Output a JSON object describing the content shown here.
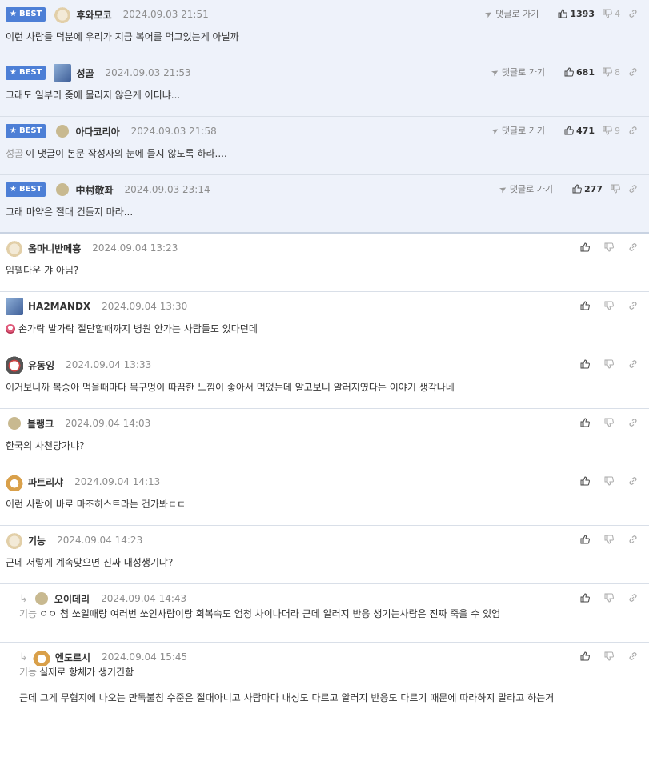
{
  "goto_label": "댓글로 가기",
  "best_label": "BEST",
  "colors": {
    "best_badge": "#4d7fd6",
    "best_bg": "#eef2fa",
    "divider": "#d9dfe8"
  },
  "best_comments": [
    {
      "nick": "후와모코",
      "date": "2024.09.03 21:51",
      "text": "이런 사람들 덕분에 우리가 지금 복어를 먹고있는게 아닐까",
      "up": "1393",
      "down": "4",
      "avatar": "puppy-avatar"
    },
    {
      "nick": "성골",
      "date": "2024.09.03 21:53",
      "text": "그래도 일부러 좆에 물리지 않은게 어디냐...",
      "up": "681",
      "down": "8",
      "avatar": "wolf-avatar"
    },
    {
      "nick": "아다코리아",
      "date": "2024.09.03 21:58",
      "mention": "성골",
      "text": "이 댓글이 본문 작성자의 눈에 들지 않도록 하라....",
      "up": "471",
      "down": "9",
      "avatar": "default-avatar"
    },
    {
      "nick": "中村敬좌",
      "date": "2024.09.03 23:14",
      "text": "그래 마약은 절대 건들지 마라...",
      "up": "277",
      "down": "",
      "avatar": "default-avatar"
    }
  ],
  "comments": [
    {
      "nick": "옴마니반메훙",
      "date": "2024.09.04 13:23",
      "text": "임펠다운 갸 아님?"
    },
    {
      "nick": "HA2MANDX",
      "date": "2024.09.04 13:30",
      "text": "손가락 발가락 절단할때까지 병원 안가는 사람들도 있다던데"
    },
    {
      "nick": "유동잉",
      "date": "2024.09.04 13:33",
      "text": "이거보니까 복숭아 먹을때마다 목구멍이 따끔한 느낌이 좋아서 먹었는데 알고보니 알러지였다는 이야기 생각나네"
    },
    {
      "nick": "블랭크",
      "date": "2024.09.04 14:03",
      "text": "한국의 사천당가냐?"
    },
    {
      "nick": "파트리샤",
      "date": "2024.09.04 14:13",
      "text": "이런 사람이 바로 마조히스트라는 건가봐ㄷㄷ"
    },
    {
      "nick": "기능",
      "date": "2024.09.04 14:23",
      "text": "근데 저렇게 계속맞으면 진짜 내성생기냐?"
    }
  ],
  "replies": [
    {
      "nick": "오이데리",
      "date": "2024.09.04 14:43",
      "mention": "기능",
      "text": "ㅇㅇ 첨 쏘일때랑 여러번 쏘인사람이랑 회복속도 엄청 차이나더라 근데 알러지 반응 생기는사람은 진짜 죽을 수 있엄"
    },
    {
      "nick": "엔도르시",
      "date": "2024.09.04 15:45",
      "mention": "기능",
      "text": "실제로 항체가 생기긴함",
      "text2": "근데 그게 무협지에 나오는 만독불침 수준은 절대아니고 사람마다 내성도 다르고 알러지 반응도 다르기 때문에 따라하지 말라고 하는거"
    }
  ]
}
